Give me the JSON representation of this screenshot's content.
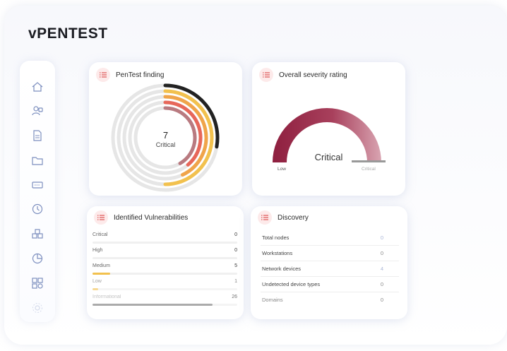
{
  "brand": {
    "logo": "vPENTEST"
  },
  "sidebar": {
    "items": [
      {
        "icon": "home-icon"
      },
      {
        "icon": "users-icon"
      },
      {
        "icon": "document-icon"
      },
      {
        "icon": "folder-icon"
      },
      {
        "icon": "ticket-icon"
      },
      {
        "icon": "clock-icon"
      },
      {
        "icon": "boxes-icon"
      },
      {
        "icon": "pie-chart-icon"
      },
      {
        "icon": "grid-icon"
      },
      {
        "icon": "settings-icon"
      }
    ]
  },
  "pentest_finding": {
    "title": "PenTest finding",
    "count": "7",
    "label": "Critical",
    "rings_colors": [
      "#222222",
      "#f2c14e",
      "#f0a44a",
      "#e7675a",
      "#b97a80"
    ]
  },
  "severity": {
    "title": "Overall severity rating",
    "value": "Critical",
    "min_label": "Low",
    "max_label": "Critical",
    "level": 1.0
  },
  "vulnerabilities": {
    "title": "Identified Vulnerabilities",
    "rows": [
      {
        "name": "Critical",
        "count": "0",
        "fraction": 0,
        "color": "#e05a5a"
      },
      {
        "name": "High",
        "count": "0",
        "fraction": 0,
        "color": "#f09a4a"
      },
      {
        "name": "Medium",
        "count": "5",
        "fraction": 0.12,
        "color": "#f2c14e"
      },
      {
        "name": "Low",
        "count": "1",
        "fraction": 0.04,
        "color": "#f2c14e"
      },
      {
        "name": "Informational",
        "count": "26",
        "fraction": 0.83,
        "color": "#888888"
      }
    ]
  },
  "discovery": {
    "title": "Discovery",
    "rows": [
      {
        "name": "Total nodes",
        "count": "0"
      },
      {
        "name": "Workstations",
        "count": "0"
      },
      {
        "name": "Network devices",
        "count": "4"
      },
      {
        "name": "Undetected device types",
        "count": "0"
      },
      {
        "name": "Domains",
        "count": "0"
      }
    ]
  }
}
